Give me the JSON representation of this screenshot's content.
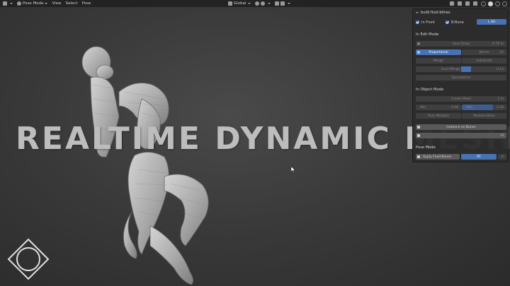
{
  "header": {
    "mode": "Pose Mode",
    "menus": [
      "View",
      "Select",
      "Pose"
    ],
    "transform_orientation": "Global"
  },
  "overlay": {
    "title": "REALTIME DYNAMIC MESH"
  },
  "panel": {
    "title": "build fluid b0nes",
    "in_front_label": "In Front",
    "bbone_label": "B-Bone",
    "layer_button": "L A0",
    "edit_mode_heading": "In Edit Mode",
    "scan_draw": {
      "label": "Scan Draw",
      "value": "0.79 m"
    },
    "proportional": {
      "label": "Proportional",
      "bones_label": "Bones",
      "bones_value": "22"
    },
    "merge_label": "Merge",
    "subdivide_label": "Subdivide",
    "scan_merge": {
      "label": "Scan Merge",
      "value": "0.13"
    },
    "symmetrize_label": "Symmetrize",
    "object_mode_heading": "In Object Mode",
    "create_mesh": {
      "label": "Create Mesh",
      "value": "1 m"
    },
    "min": {
      "label": "Min",
      "value": "0.46"
    },
    "max": {
      "label": "Max",
      "value": "2.44"
    },
    "auto_weights_label": "Auto Weights",
    "restore_bone_label": "Restore Bone",
    "instance_on_bones_label": "Instance on Bones",
    "pose_mode_heading": "Pose Mode",
    "apply_fluid_bones_label": "Apply Fluid Bones",
    "rt_label": "RT",
    "fl_label": "Fl"
  },
  "colors": {
    "accent": "#4772b3",
    "panel_bg": "#2c2c2c",
    "header_bg": "#232323",
    "mesh": "#b8b8b8"
  }
}
